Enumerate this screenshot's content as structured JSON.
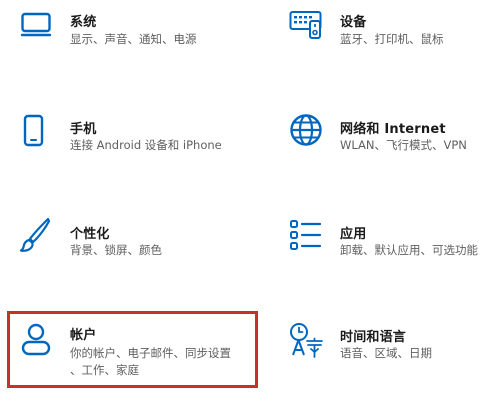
{
  "colors": {
    "accent": "#0067c0",
    "highlight": "#c8302a"
  },
  "tiles": {
    "system": {
      "icon": "monitor-icon",
      "title": "系统",
      "desc": "显示、声音、通知、电源"
    },
    "devices": {
      "icon": "keyboard-device-icon",
      "title": "设备",
      "desc": "蓝牙、打印机、鼠标"
    },
    "phone": {
      "icon": "phone-icon",
      "title": "手机",
      "desc": "连接 Android 设备和 iPhone"
    },
    "network": {
      "icon": "globe-icon",
      "title": "网络和 Internet",
      "desc": "WLAN、飞行模式、VPN"
    },
    "personal": {
      "icon": "paintbrush-icon",
      "title": "个性化",
      "desc": "背景、锁屏、颜色"
    },
    "apps": {
      "icon": "app-list-icon",
      "title": "应用",
      "desc": "卸载、默认应用、可选功能"
    },
    "accounts": {
      "icon": "person-icon",
      "title": "帐户",
      "desc1": "你的帐户、电子邮件、同步设置",
      "desc2": "、工作、家庭"
    },
    "time": {
      "icon": "clock-language-icon",
      "title": "时间和语言",
      "desc": "语音、区域、日期"
    }
  }
}
